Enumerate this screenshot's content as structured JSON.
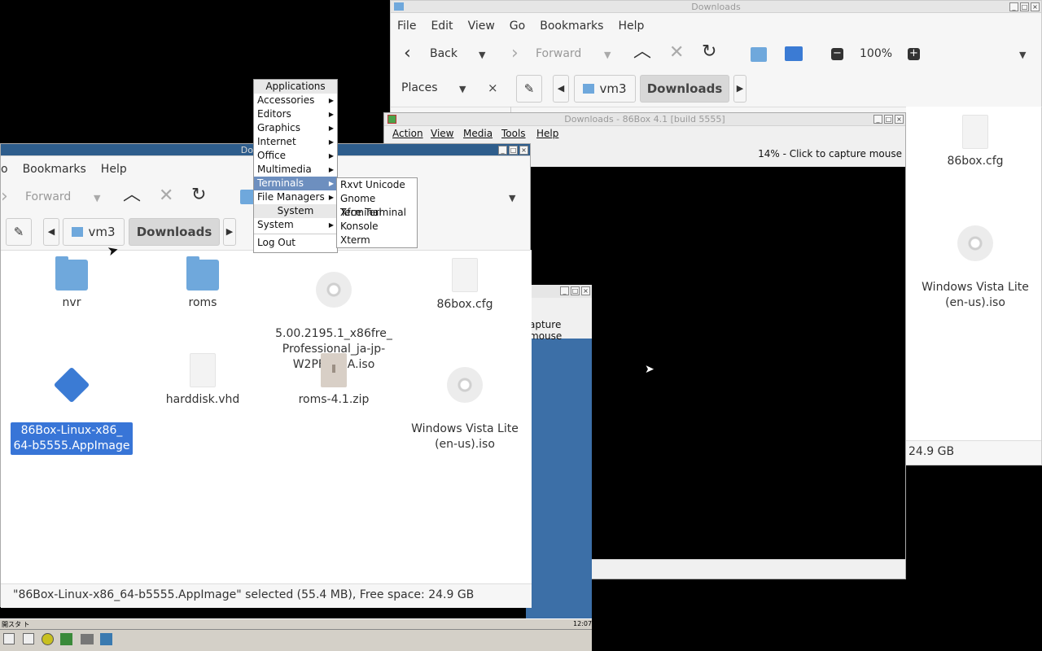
{
  "back_window": {
    "title": "Downloads",
    "menu": [
      "File",
      "Edit",
      "View",
      "Go",
      "Bookmarks",
      "Help"
    ],
    "toolbar": {
      "back": "Back",
      "forward": "Forward",
      "zoom": "100%"
    },
    "places": "Places",
    "path": [
      "vm3",
      "Downloads"
    ],
    "files": [
      {
        "name": "86box.cfg",
        "type": "doc"
      },
      {
        "name": "Windows Vista Lite\n(en-us).iso",
        "type": "disc"
      }
    ],
    "free_space": "24.9 GB"
  },
  "box_window": {
    "title": "Downloads - 86Box 4.1 [build 5555]",
    "menu": [
      "Action",
      "View",
      "Media",
      "Tools",
      "Help"
    ],
    "status": "14% - Click to capture mouse"
  },
  "small_window": {
    "status": "apture mouse"
  },
  "front_window": {
    "title": "Downloads",
    "menu": [
      "o",
      "Bookmarks",
      "Help"
    ],
    "toolbar": {
      "forward": "Forward"
    },
    "path": [
      "vm3",
      "Downloads"
    ],
    "files": [
      {
        "name": "nvr",
        "type": "folder"
      },
      {
        "name": "roms",
        "type": "folder"
      },
      {
        "name": "5.00.2195.1_x86fre_\nProfessional_ja-jp-\nW2PFPP_JA.iso",
        "type": "disc"
      },
      {
        "name": "86box.cfg",
        "type": "doc"
      },
      {
        "name": "86Box-Linux-x86_\n64-b5555.AppImage",
        "type": "app"
      },
      {
        "name": "harddisk.vhd",
        "type": "doc"
      },
      {
        "name": "roms-4.1.zip",
        "type": "zip"
      },
      {
        "name": "Windows Vista Lite\n(en-us).iso",
        "type": "disc"
      }
    ],
    "statusbar": "\"86Box-Linux-x86_64-b5555.AppImage\" selected (55.4 MB), Free space: 24.9 GB"
  },
  "app_menu": {
    "header": "Applications",
    "items": [
      "Accessories",
      "Editors",
      "Graphics",
      "Internet",
      "Office",
      "Multimedia",
      "Terminals",
      "File Managers"
    ],
    "system_header": "System",
    "system_items": [
      "System"
    ],
    "logout": "Log Out",
    "submenu": [
      "Rxvt Unicode",
      "Gnome Terminal",
      "Xfce Terminal",
      "Konsole",
      "Xterm"
    ]
  },
  "taskbar": {
    "start": "開スタ ト",
    "clock": "12:07"
  }
}
